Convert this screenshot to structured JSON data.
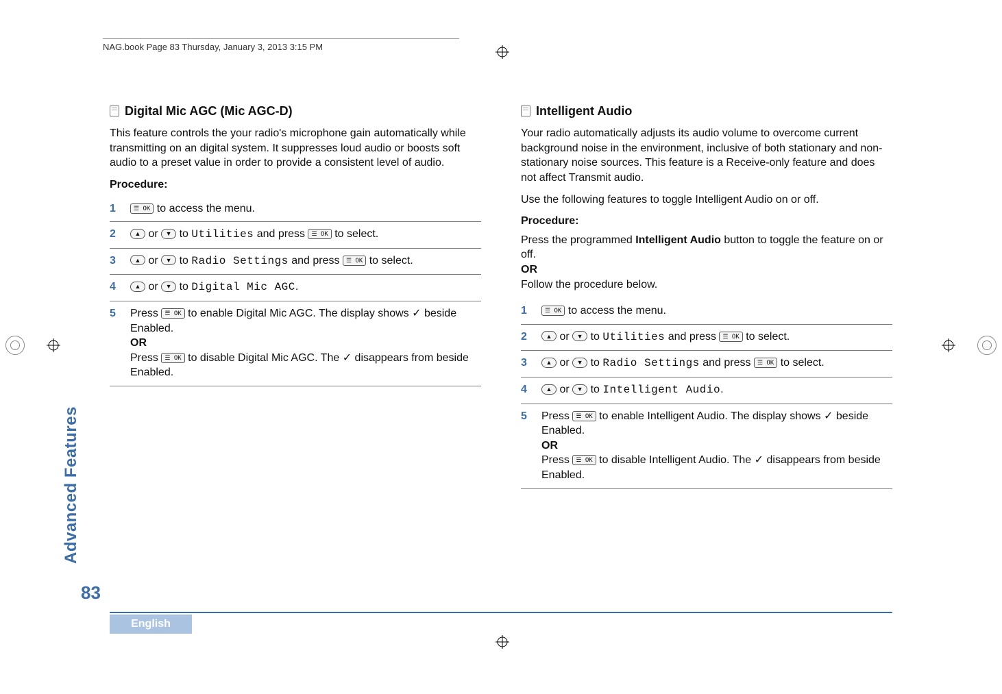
{
  "running_head": "NAG.book  Page 83  Thursday, January 3, 2013  3:15 PM",
  "side_tab": "Advanced Features",
  "page_number": "83",
  "language": "English",
  "icons": {
    "menu_ok": "☰ OK",
    "up": "▲",
    "down": "▼",
    "check": "✓"
  },
  "left": {
    "heading": "Digital Mic AGC (Mic AGC-D)",
    "intro": "This feature controls the your radio's microphone gain automatically while transmitting on an digital system. It suppresses loud audio or boosts soft audio to a preset value in order to provide a consistent level of audio.",
    "procedure_label": "Procedure:",
    "steps": [
      {
        "n": "1",
        "pre": "",
        "mid": " to access the menu."
      },
      {
        "n": "2",
        "menu": "Utilities",
        "tail": " to select."
      },
      {
        "n": "3",
        "menu": "Radio Settings",
        "tail": " to select."
      },
      {
        "n": "4",
        "menu": "Digital Mic AGC",
        "tail": "."
      },
      {
        "n": "5",
        "line1a": "Press ",
        "line1b": " to enable Digital Mic AGC. The display shows ",
        "line1c": " beside Enabled.",
        "or": "OR",
        "line2a": "Press ",
        "line2b": " to disable Digital Mic AGC. The ",
        "line2c": " disappears from beside Enabled."
      }
    ]
  },
  "right": {
    "heading": "Intelligent Audio",
    "intro1": "Your radio automatically adjusts its audio volume to overcome current background noise in the environment, inclusive of both stationary and non-stationary noise sources. This feature is a Receive-only feature and does not affect Transmit audio.",
    "intro2": "Use the following features to toggle Intelligent Audio on or off.",
    "procedure_label": "Procedure:",
    "pre_step_a": "Press the programmed ",
    "pre_step_bold": "Intelligent Audio",
    "pre_step_b": " button to toggle the feature on or off.",
    "or": "OR",
    "pre_step_c": "Follow the procedure below.",
    "steps": [
      {
        "n": "1",
        "mid": " to access the menu."
      },
      {
        "n": "2",
        "menu": "Utilities",
        "tail": " to select."
      },
      {
        "n": "3",
        "menu": "Radio Settings",
        "tail": " to select."
      },
      {
        "n": "4",
        "menu": "Intelligent Audio",
        "tail": "."
      },
      {
        "n": "5",
        "line1a": "Press ",
        "line1b": " to enable Intelligent Audio. The display shows ",
        "line1c": " beside Enabled.",
        "or": "OR",
        "line2a": "Press ",
        "line2b": " to disable Intelligent Audio. The ",
        "line2c": " disappears from beside Enabled."
      }
    ]
  }
}
